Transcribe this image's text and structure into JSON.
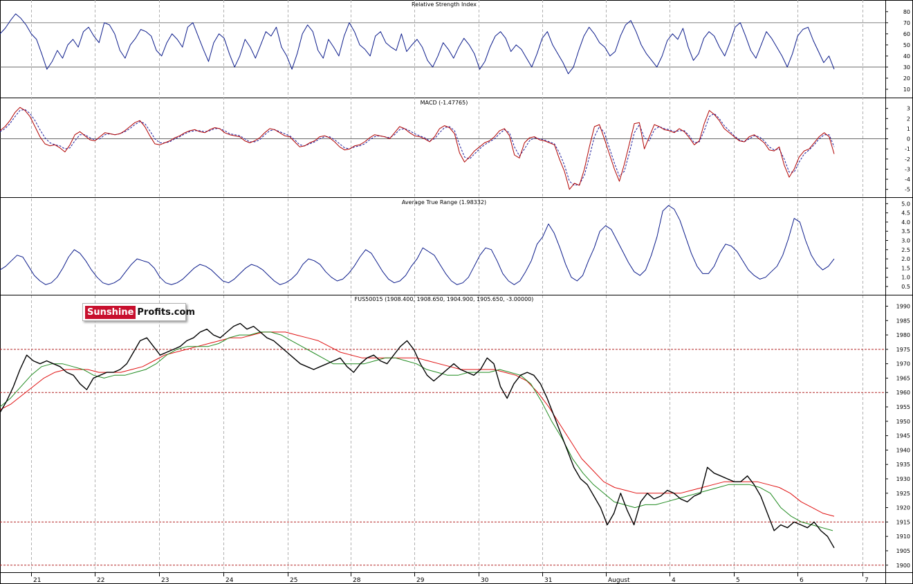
{
  "chart_data": [
    {
      "type": "line",
      "title": "Relative Strength Index",
      "ylim": [
        5,
        88
      ],
      "yticks": [
        10,
        20,
        30,
        40,
        50,
        60,
        70,
        80
      ],
      "reference_lines": [
        30,
        70
      ],
      "colors": {
        "series": "#0a1a8a"
      },
      "series": [
        {
          "values": [
            60,
            65,
            72,
            78,
            74,
            68,
            60,
            55,
            42,
            28,
            35,
            45,
            38,
            50,
            55,
            48,
            62,
            66,
            58,
            52,
            70,
            68,
            60,
            45,
            38,
            50,
            56,
            64,
            62,
            58,
            45,
            40,
            52,
            60,
            55,
            48,
            66,
            70,
            58,
            46,
            35,
            52,
            60,
            56,
            42,
            30,
            40,
            55,
            48,
            38,
            50,
            62,
            58,
            66,
            48,
            40,
            28,
            42,
            60,
            68,
            62,
            45,
            38,
            55,
            48,
            40,
            58,
            70,
            62,
            50,
            46,
            40,
            58,
            62,
            52,
            48,
            45,
            60,
            44,
            50,
            55,
            48,
            36,
            30,
            40,
            52,
            46,
            38,
            48,
            56,
            50,
            42,
            28,
            35,
            48,
            58,
            62,
            56,
            44,
            50,
            46,
            38,
            30,
            42,
            56,
            62,
            50,
            42,
            34,
            24,
            30,
            45,
            58,
            66,
            60,
            52,
            48,
            40,
            44,
            58,
            68,
            72,
            62,
            50,
            42,
            36,
            30,
            40,
            54,
            60,
            55,
            65,
            48,
            36,
            42,
            56,
            62,
            58,
            48,
            40,
            52,
            66,
            70,
            58,
            45,
            38,
            50,
            62,
            56,
            48,
            40,
            30,
            42,
            58,
            64,
            66,
            54,
            44,
            34,
            40,
            28
          ]
        }
      ]
    },
    {
      "type": "line",
      "title": "MACD (-1.47765)",
      "ylim": [
        -5.5,
        3.8
      ],
      "yticks": [
        -5,
        -4,
        -3,
        -2,
        -1,
        0,
        1,
        2,
        3
      ],
      "reference_lines": [
        0
      ],
      "colors": {
        "macd": "#b00000",
        "signal": "#1a1a9a"
      },
      "series": [
        {
          "values": [
            0.8,
            1.2,
            1.8,
            2.6,
            3.1,
            2.8,
            2.2,
            1.2,
            0.2,
            -0.5,
            -0.7,
            -0.6,
            -0.9,
            -1.3,
            -0.6,
            0.4,
            0.7,
            0.3,
            -0.1,
            -0.2,
            0.2,
            0.6,
            0.5,
            0.4,
            0.5,
            0.8,
            1.2,
            1.6,
            1.8,
            1.2,
            0.3,
            -0.5,
            -0.6,
            -0.4,
            -0.2,
            0.1,
            0.3,
            0.6,
            0.8,
            0.9,
            0.7,
            0.6,
            0.9,
            1.1,
            1.0,
            0.6,
            0.4,
            0.3,
            0.2,
            -0.2,
            -0.4,
            -0.2,
            0.1,
            0.6,
            1.0,
            0.9,
            0.6,
            0.3,
            0.2,
            -0.3,
            -0.8,
            -0.7,
            -0.4,
            -0.2,
            0.2,
            0.3,
            0.1,
            -0.3,
            -0.8,
            -1.1,
            -1.0,
            -0.7,
            -0.6,
            -0.3,
            0.1,
            0.4,
            0.3,
            0.2,
            0.0,
            0.6,
            1.2,
            1.0,
            0.6,
            0.3,
            0.2,
            0.0,
            -0.3,
            0.2,
            1.0,
            1.3,
            1.1,
            0.5,
            -1.4,
            -2.3,
            -1.8,
            -1.2,
            -0.8,
            -0.4,
            -0.2,
            0.2,
            0.8,
            1.0,
            0.3,
            -1.6,
            -1.9,
            -0.4,
            0.1,
            0.2,
            -0.1,
            -0.2,
            -0.4,
            -0.6,
            -2.0,
            -3.2,
            -5.0,
            -4.4,
            -4.6,
            -3.0,
            -0.8,
            1.2,
            1.4,
            0.0,
            -1.5,
            -3.0,
            -4.2,
            -2.5,
            -0.5,
            1.5,
            1.6,
            -1.0,
            0.2,
            1.4,
            1.2,
            0.9,
            0.8,
            0.6,
            1.0,
            0.7,
            0.1,
            -0.6,
            -0.2,
            1.5,
            2.8,
            2.4,
            1.8,
            1.0,
            0.6,
            0.2,
            -0.2,
            -0.3,
            0.2,
            0.4,
            0.0,
            -0.4,
            -1.1,
            -1.2,
            -0.8,
            -2.6,
            -3.8,
            -3.0,
            -1.8,
            -1.2,
            -1.0,
            -0.4,
            0.2,
            0.6,
            0.2,
            -1.5
          ]
        },
        {
          "values": [
            0.7,
            1.0,
            1.5,
            2.2,
            2.8,
            2.9,
            2.5,
            1.8,
            0.9,
            0.1,
            -0.4,
            -0.6,
            -0.7,
            -1.0,
            -0.9,
            -0.2,
            0.4,
            0.4,
            0.1,
            -0.1,
            0.0,
            0.4,
            0.5,
            0.4,
            0.5,
            0.7,
            1.0,
            1.4,
            1.7,
            1.5,
            0.8,
            0.0,
            -0.4,
            -0.4,
            -0.3,
            0.0,
            0.2,
            0.5,
            0.7,
            0.8,
            0.8,
            0.7,
            0.8,
            1.0,
            1.0,
            0.8,
            0.5,
            0.4,
            0.3,
            0.0,
            -0.3,
            -0.3,
            -0.1,
            0.4,
            0.8,
            0.9,
            0.7,
            0.5,
            0.3,
            -0.1,
            -0.6,
            -0.7,
            -0.5,
            -0.3,
            0.0,
            0.2,
            0.2,
            -0.1,
            -0.5,
            -0.9,
            -1.0,
            -0.8,
            -0.7,
            -0.5,
            -0.1,
            0.2,
            0.3,
            0.2,
            0.1,
            0.4,
            0.9,
            1.0,
            0.8,
            0.5,
            0.3,
            0.1,
            -0.2,
            0.0,
            0.6,
            1.1,
            1.2,
            0.8,
            -0.6,
            -1.8,
            -2.0,
            -1.5,
            -1.0,
            -0.6,
            -0.3,
            0.0,
            0.5,
            0.9,
            0.6,
            -0.8,
            -1.7,
            -1.0,
            -0.2,
            0.1,
            0.0,
            -0.1,
            -0.3,
            -0.5,
            -1.4,
            -2.6,
            -4.2,
            -4.6,
            -4.5,
            -3.6,
            -1.8,
            0.2,
            1.2,
            0.6,
            -0.9,
            -2.4,
            -3.7,
            -3.2,
            -1.4,
            0.6,
            1.4,
            0.1,
            -0.2,
            0.9,
            1.2,
            1.0,
            0.9,
            0.7,
            0.8,
            0.8,
            0.3,
            -0.4,
            -0.3,
            0.8,
            2.2,
            2.5,
            2.0,
            1.3,
            0.8,
            0.3,
            -0.1,
            -0.3,
            0.0,
            0.3,
            0.2,
            -0.2,
            -0.8,
            -1.1,
            -1.0,
            -2.0,
            -3.3,
            -3.3,
            -2.3,
            -1.5,
            -1.1,
            -0.6,
            0.0,
            0.4,
            0.4,
            -0.8
          ]
        }
      ]
    },
    {
      "type": "line",
      "title": "Average True Range (1.98332)",
      "ylim": [
        0.2,
        5.2
      ],
      "yticks": [
        0.5,
        1.0,
        1.5,
        2.0,
        2.5,
        3.0,
        3.5,
        4.0,
        4.5,
        5.0
      ],
      "colors": {
        "series": "#0a1a8a"
      },
      "series": [
        {
          "values": [
            1.4,
            1.6,
            1.9,
            2.2,
            2.1,
            1.6,
            1.1,
            0.8,
            0.6,
            0.7,
            1.0,
            1.5,
            2.1,
            2.5,
            2.3,
            1.9,
            1.4,
            1.0,
            0.7,
            0.6,
            0.7,
            0.9,
            1.3,
            1.7,
            2.0,
            1.9,
            1.8,
            1.5,
            1.0,
            0.7,
            0.6,
            0.7,
            0.9,
            1.2,
            1.5,
            1.7,
            1.6,
            1.4,
            1.1,
            0.8,
            0.7,
            0.9,
            1.2,
            1.5,
            1.7,
            1.6,
            1.4,
            1.1,
            0.8,
            0.6,
            0.7,
            0.9,
            1.2,
            1.7,
            2.0,
            1.9,
            1.7,
            1.3,
            1.0,
            0.8,
            0.9,
            1.2,
            1.6,
            2.1,
            2.5,
            2.3,
            1.8,
            1.3,
            0.9,
            0.7,
            0.8,
            1.1,
            1.6,
            2.0,
            2.6,
            2.4,
            2.2,
            1.7,
            1.2,
            0.8,
            0.6,
            0.7,
            1.0,
            1.6,
            2.2,
            2.6,
            2.5,
            1.9,
            1.2,
            0.8,
            0.6,
            0.8,
            1.3,
            1.9,
            2.8,
            3.2,
            3.9,
            3.4,
            2.6,
            1.7,
            1.0,
            0.8,
            1.1,
            1.9,
            2.6,
            3.5,
            3.8,
            3.6,
            3.0,
            2.4,
            1.8,
            1.3,
            1.1,
            1.4,
            2.2,
            3.2,
            4.6,
            4.9,
            4.7,
            4.1,
            3.2,
            2.3,
            1.6,
            1.2,
            1.2,
            1.6,
            2.3,
            2.8,
            2.7,
            2.4,
            1.9,
            1.4,
            1.1,
            0.9,
            1.0,
            1.3,
            1.6,
            2.2,
            3.1,
            4.2,
            4.0,
            3.0,
            2.2,
            1.7,
            1.4,
            1.6,
            2.0
          ]
        }
      ]
    },
    {
      "type": "line",
      "title": "FUS50015 (1908.400, 1908.650, 1904.900, 1905.650, -3.00000)",
      "ylim": [
        1898.5,
        1993
      ],
      "yticks": [
        1900,
        1905,
        1910,
        1915,
        1920,
        1925,
        1930,
        1935,
        1940,
        1945,
        1950,
        1955,
        1960,
        1965,
        1970,
        1975,
        1980,
        1985,
        1990
      ],
      "reference_lines": [
        1960,
        1975,
        1915,
        1900
      ],
      "x_labels": [
        "21",
        "22",
        "23",
        "24",
        "25",
        "28",
        "29",
        "30",
        "31",
        "August",
        "4",
        "5",
        "6",
        "7"
      ],
      "colors": {
        "price": "#000000",
        "ma_fast": "#1f8a1f",
        "ma_slow": "#e01010",
        "reference": "#b22222",
        "grid": "#b0b0b0"
      },
      "series": [
        {
          "name": "price",
          "values": [
            1953,
            1957,
            1962,
            1968,
            1973,
            1971,
            1970,
            1971,
            1970,
            1969,
            1967,
            1966,
            1963,
            1961,
            1965,
            1966,
            1967,
            1967,
            1968,
            1970,
            1974,
            1978,
            1979,
            1976,
            1973,
            1974,
            1975,
            1976,
            1978,
            1979,
            1981,
            1982,
            1980,
            1979,
            1981,
            1983,
            1984,
            1982,
            1983,
            1981,
            1979,
            1978,
            1976,
            1974,
            1972,
            1970,
            1969,
            1968,
            1969,
            1970,
            1971,
            1972,
            1969,
            1967,
            1970,
            1972,
            1973,
            1971,
            1970,
            1973,
            1976,
            1978,
            1975,
            1970,
            1966,
            1964,
            1966,
            1968,
            1970,
            1968,
            1967,
            1966,
            1968,
            1972,
            1970,
            1962,
            1958,
            1963,
            1966,
            1967,
            1966,
            1963,
            1958,
            1952,
            1946,
            1940,
            1934,
            1930,
            1928,
            1924,
            1920,
            1914,
            1918,
            1925,
            1919,
            1914,
            1922,
            1925,
            1923,
            1924,
            1926,
            1925,
            1923,
            1922,
            1924,
            1925,
            1934,
            1932,
            1931,
            1930,
            1929,
            1929,
            1931,
            1928,
            1924,
            1918,
            1912,
            1914,
            1913,
            1915,
            1914,
            1913,
            1915,
            1912,
            1910,
            1906
          ]
        },
        {
          "name": "ma_fast",
          "values": [
            1955,
            1958,
            1962,
            1966,
            1969,
            1970,
            1970,
            1969,
            1968,
            1966,
            1965,
            1966,
            1966,
            1967,
            1968,
            1970,
            1973,
            1975,
            1976,
            1976,
            1976,
            1977,
            1979,
            1980,
            1980,
            1981,
            1981,
            1980,
            1978,
            1976,
            1974,
            1972,
            1970,
            1970,
            1970,
            1970,
            1971,
            1972,
            1972,
            1971,
            1970,
            1968,
            1967,
            1966,
            1966,
            1967,
            1967,
            1967,
            1968,
            1967,
            1966,
            1963,
            1957,
            1950,
            1944,
            1937,
            1932,
            1928,
            1925,
            1922,
            1921,
            1920,
            1921,
            1921,
            1922,
            1923,
            1924,
            1925,
            1926,
            1927,
            1928,
            1928,
            1928,
            1927,
            1925,
            1920,
            1917,
            1915,
            1914,
            1913,
            1912
          ]
        },
        {
          "name": "ma_slow",
          "values": [
            1954,
            1956,
            1959,
            1962,
            1965,
            1967,
            1968,
            1968,
            1968,
            1967,
            1967,
            1967,
            1968,
            1969,
            1971,
            1973,
            1974,
            1975,
            1976,
            1977,
            1978,
            1979,
            1979,
            1980,
            1981,
            1981,
            1981,
            1980,
            1979,
            1978,
            1976,
            1974,
            1973,
            1972,
            1972,
            1972,
            1972,
            1972,
            1972,
            1971,
            1970,
            1969,
            1968,
            1968,
            1968,
            1968,
            1967,
            1966,
            1964,
            1960,
            1955,
            1949,
            1943,
            1937,
            1933,
            1929,
            1927,
            1926,
            1925,
            1925,
            1925,
            1925,
            1925,
            1926,
            1927,
            1928,
            1929,
            1929,
            1929,
            1929,
            1928,
            1927,
            1925,
            1922,
            1920,
            1918,
            1917
          ]
        }
      ]
    }
  ]
}
